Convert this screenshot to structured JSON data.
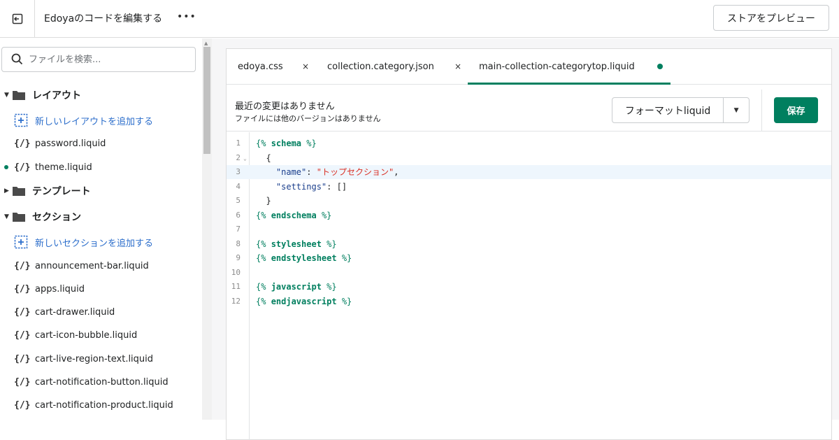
{
  "topbar": {
    "title": "Edoyaのコードを編集する",
    "more_label": "•••",
    "preview_label": "ストアをプレビュー"
  },
  "sidebar": {
    "search_placeholder": "ファイルを検索...",
    "layout_folder": "レイアウト",
    "add_layout": "新しいレイアウトを追加する",
    "layout_files": [
      "password.liquid",
      "theme.liquid"
    ],
    "template_folder": "テンプレート",
    "section_folder": "セクション",
    "add_section": "新しいセクションを追加する",
    "section_files": [
      "announcement-bar.liquid",
      "apps.liquid",
      "cart-drawer.liquid",
      "cart-icon-bubble.liquid",
      "cart-live-region-text.liquid",
      "cart-notification-button.liquid",
      "cart-notification-product.liquid"
    ],
    "file_icon": "{/}"
  },
  "tabs": [
    {
      "label": "edoya.css"
    },
    {
      "label": "collection.category.json"
    },
    {
      "label": "main-collection-categorytop.liquid"
    }
  ],
  "tab_close": "×",
  "info": {
    "title": "最近の変更はありません",
    "subtitle": "ファイルには他のバージョンはありません",
    "format_label": "フォーマットliquid",
    "save_label": "保存"
  },
  "code": {
    "line_numbers": [
      "1",
      "2",
      "3",
      "4",
      "5",
      "6",
      "7",
      "8",
      "9",
      "10",
      "11",
      "12"
    ],
    "lines": [
      "{% schema %}",
      "  {",
      "    \"name\": \"トップセクション\",",
      "    \"settings\": []",
      "  }",
      "{% endschema %}",
      "",
      "{% stylesheet %}",
      "{% endstylesheet %}",
      "",
      "{% javascript %}",
      "{% endjavascript %}"
    ]
  },
  "colors": {
    "accent": "#007f5f",
    "link": "#2c6ecb",
    "string": "#d93025"
  }
}
